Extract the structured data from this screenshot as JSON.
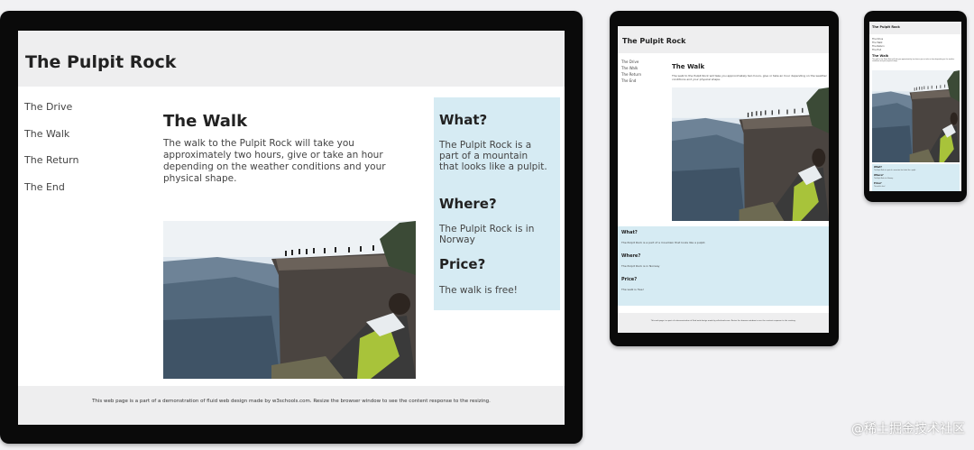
{
  "site": {
    "title": "The Pulpit Rock",
    "nav": [
      "The Drive",
      "The Walk",
      "The Return",
      "The End"
    ],
    "main": {
      "heading": "The Walk",
      "text": "The walk to the Pulpit Rock will take you approximately two hours, give or take an hour depending on the weather conditions and your physical shape."
    },
    "aside": [
      {
        "heading": "What?",
        "text": "The Pulpit Rock is a part of a mountain that looks like a pulpit."
      },
      {
        "heading": "Where?",
        "text": "The Pulpit Rock is in Norway"
      },
      {
        "heading": "Price?",
        "text": "The walk is free!"
      }
    ],
    "footer": "This web page is a part of a demonstration of fluid web design made by w3schools.com. Resize the browser window to see the content response to the resizing."
  },
  "watermark": "@稀土掘金技术社区",
  "colors": {
    "aside_bg": "#d6ebf3",
    "header_bg": "#eeeeef",
    "device_frame": "#0a0a0a"
  }
}
